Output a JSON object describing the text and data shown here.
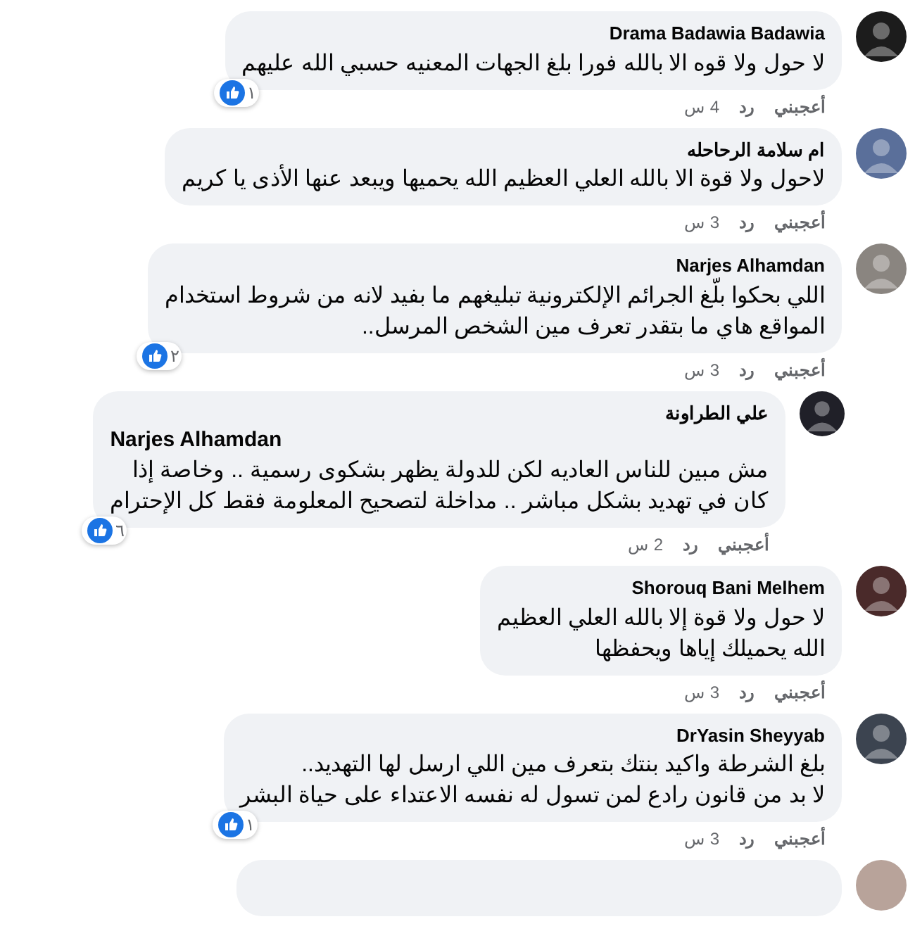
{
  "comments": [
    {
      "kind": "comment",
      "author": "Drama Badawia Badawia",
      "text": "لا حول ولا قوه الا بالله فورا بلغ الجهات المعنيه حسبي الله عليهم",
      "reactions": "١",
      "actions": [
        "أعجبني",
        "رد"
      ],
      "time": "4 س"
    },
    {
      "kind": "comment",
      "author": "ام سلامة الرحاحله",
      "text": "لاحول ولا قوة الا بالله العلي العظيم الله يحميها ويبعد عنها الأذى يا كريم",
      "actions": [
        "أعجبني",
        "رد"
      ],
      "time": "3 س"
    },
    {
      "kind": "comment",
      "author": "Narjes Alhamdan",
      "text": "اللي بحكوا بلّغ الجرائم الإلكترونية تبليغهم ما بفيد لانه من شروط استخدام\nالمواقع هاي ما بتقدر تعرف مين الشخص المرسل..",
      "reactions": "٢",
      "actions": [
        "أعجبني",
        "رد"
      ],
      "time": "3 س"
    },
    {
      "kind": "reply",
      "author": "علي الطراونة",
      "mention": "Narjes Alhamdan",
      "text": "مش مبين للناس العاديه لكن للدولة يظهر بشكوى رسمية .. وخاصة إذا\nكان في تهديد بشكل مباشر .. مداخلة لتصحيح المعلومة فقط كل الإحترام",
      "reactions": "٦",
      "actions": [
        "أعجبني",
        "رد"
      ],
      "time": "2 س"
    },
    {
      "kind": "comment",
      "author": "Shorouq Bani Melhem",
      "text": "لا حول ولا قوة إلا بالله العلي العظيم\nالله يحميلك إياها ويحفظها",
      "actions": [
        "أعجبني",
        "رد"
      ],
      "time": "3 س"
    },
    {
      "kind": "comment",
      "author": "DrYasin Sheyyab",
      "text": "بلغ الشرطة واكيد بنتك بتعرف مين اللي ارسل لها التهديد..\nلا بد من قانون رادع لمن تسول له نفسه الاعتداء على حياة البشر",
      "reactions": "١",
      "actions": [
        "أعجبني",
        "رد"
      ],
      "time": "3 س"
    }
  ]
}
